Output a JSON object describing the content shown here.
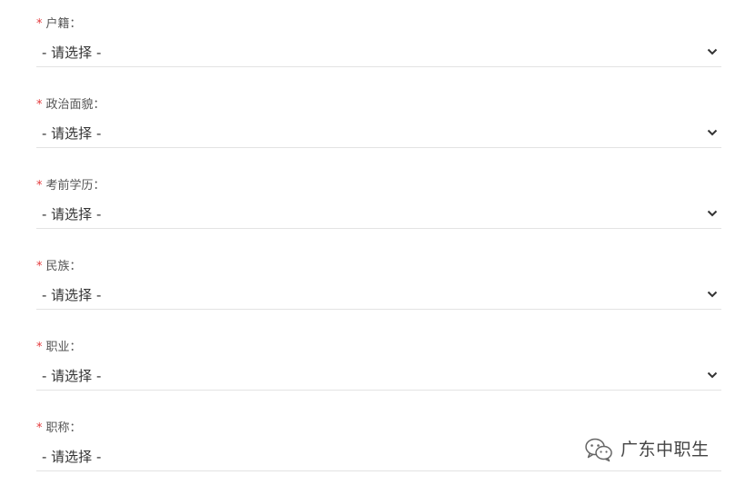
{
  "form": {
    "fields": [
      {
        "required_mark": "*",
        "label": "户籍：",
        "value": "- 请选择 -"
      },
      {
        "required_mark": "*",
        "label": "政治面貌：",
        "value": "- 请选择 -"
      },
      {
        "required_mark": "*",
        "label": "考前学历：",
        "value": "- 请选择 -"
      },
      {
        "required_mark": "*",
        "label": "民族：",
        "value": "- 请选择 -"
      },
      {
        "required_mark": "*",
        "label": "职业：",
        "value": "- 请选择 -"
      },
      {
        "required_mark": "*",
        "label": "职称：",
        "value": "- 请选择 -"
      }
    ]
  },
  "watermark": {
    "icon": "wechat-icon",
    "text": "广东中职生"
  },
  "colors": {
    "required": "#e4393c",
    "label": "#555555",
    "value": "#333333",
    "divider": "#e3e3e3"
  }
}
